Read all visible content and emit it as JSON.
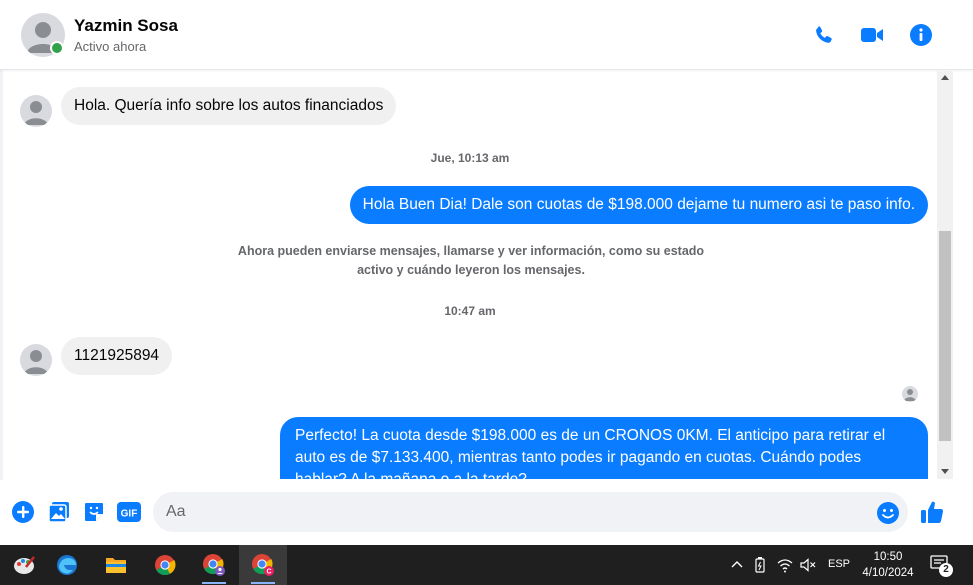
{
  "header": {
    "name": "Yazmin Sosa",
    "status": "Activo ahora"
  },
  "messages": {
    "msg1": "Hola. Quería info sobre los autos financiados",
    "ts1": "Jue, 10:13 am",
    "msg2": "Hola Buen Dia! Dale son cuotas de $198.000 dejame tu numero asi te paso info.",
    "system_line1": "Ahora pueden enviarse mensajes, llamarse y ver información, como su estado",
    "system_line2": "activo y cuándo leyeron los mensajes.",
    "ts2": "10:47 am",
    "msg3": "1121925894",
    "msg4_line1": "Perfecto! La cuota desde $198.000 es de un CRONOS 0KM. El anticipo para retirar el",
    "msg4_line2": "auto es de $7.133.400, mientras tanto podes ir pagando en cuotas. Cuándo podes",
    "msg4_line3": "hablar? A la mañana o a la tarde?"
  },
  "composer": {
    "placeholder": "Aa",
    "value": ""
  },
  "taskbar": {
    "language": "ESP",
    "time": "10:50",
    "date": "4/10/2024",
    "notification_count": "2"
  },
  "colors": {
    "accent": "#0a7cff",
    "online": "#31a24c",
    "incoming_bubble": "#f0f0f0"
  }
}
